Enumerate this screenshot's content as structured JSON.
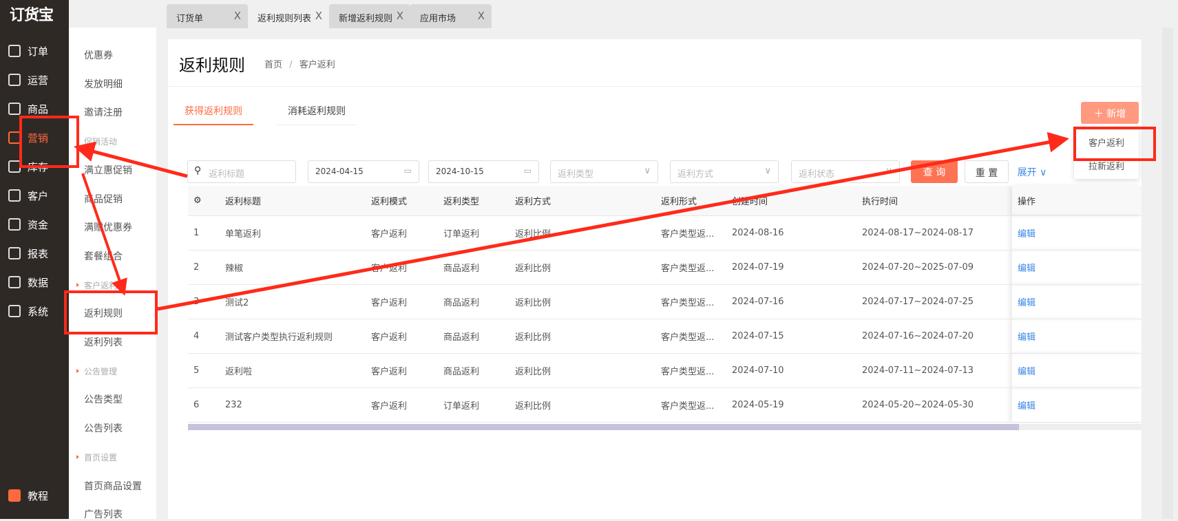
{
  "app": {
    "logo": "订货宝"
  },
  "nav": [
    {
      "label": "订单",
      "icon": "document-icon"
    },
    {
      "label": "运营",
      "icon": "chart-board-icon"
    },
    {
      "label": "商品",
      "icon": "grid-icon"
    },
    {
      "label": "营销",
      "icon": "bag-icon",
      "active": true
    },
    {
      "label": "库存",
      "icon": "warehouse-icon"
    },
    {
      "label": "客户",
      "icon": "user-icon"
    },
    {
      "label": "资金",
      "icon": "money-bag-icon"
    },
    {
      "label": "报表",
      "icon": "pie-icon"
    },
    {
      "label": "数据",
      "icon": "data-icon"
    },
    {
      "label": "系统",
      "icon": "monitor-icon"
    }
  ],
  "nav_bottom": {
    "label": "教程"
  },
  "submenu": [
    {
      "label": "优惠券"
    },
    {
      "label": "发放明细"
    },
    {
      "label": "邀请注册"
    },
    {
      "label": "促销活动",
      "group": true
    },
    {
      "label": "满立惠促销"
    },
    {
      "label": "商品促销"
    },
    {
      "label": "满赠优惠券"
    },
    {
      "label": "套餐组合"
    },
    {
      "label": "客户返利",
      "group": true
    },
    {
      "label": "返利规则"
    },
    {
      "label": "返利列表"
    },
    {
      "label": "公告管理",
      "group": true
    },
    {
      "label": "公告类型"
    },
    {
      "label": "公告列表"
    },
    {
      "label": "首页设置",
      "group": true
    },
    {
      "label": "首页商品设置"
    },
    {
      "label": "广告列表"
    }
  ],
  "tabs": [
    {
      "label": "订货单"
    },
    {
      "label": "返利规则列表",
      "active": true
    },
    {
      "label": "新增返利规则"
    },
    {
      "label": "应用市场"
    }
  ],
  "tab_close": "X",
  "page": {
    "title": "返利规则",
    "breadcrumb": [
      "首页",
      "/",
      "客户返利"
    ]
  },
  "page_tabs": [
    "获得返利规则",
    "消耗返利规则"
  ],
  "add_button": "＋ 新增",
  "add_menu": [
    "客户返利",
    "拉新返利"
  ],
  "filters": {
    "title_placeholder": "返利标题",
    "start_date": "2024-04-15",
    "end_date": "2024-10-15",
    "type_placeholder": "返利类型",
    "method_placeholder": "返利方式",
    "status_placeholder": "返利状态",
    "query": "查 询",
    "reset": "重 置",
    "expand": "展开"
  },
  "table": {
    "columns": [
      "返利标题",
      "返利模式",
      "返利类型",
      "返利方式",
      "返利形式",
      "创建时间",
      "执行时间",
      "操作"
    ],
    "rows": [
      [
        "1",
        "单笔返利",
        "客户返利",
        "订单返利",
        "返利比例",
        "客户类型返...",
        "2024-08-16",
        "2024-08-17~2024-08-17",
        "编辑"
      ],
      [
        "2",
        "辣椒",
        "客户返利",
        "商品返利",
        "返利比例",
        "客户类型返...",
        "2024-07-19",
        "2024-07-20~2025-07-09",
        "编辑"
      ],
      [
        "3",
        "测试2",
        "客户返利",
        "商品返利",
        "返利比例",
        "客户类型返...",
        "2024-07-16",
        "2024-07-17~2024-07-25",
        "编辑"
      ],
      [
        "4",
        "测试客户类型执行返利规则",
        "客户返利",
        "商品返利",
        "返利比例",
        "客户类型返...",
        "2024-07-15",
        "2024-07-16~2024-07-20",
        "编辑"
      ],
      [
        "5",
        "返利啦",
        "客户返利",
        "商品返利",
        "返利比例",
        "客户类型返...",
        "2024-07-10",
        "2024-07-11~2024-07-13",
        "编辑"
      ],
      [
        "6",
        "232",
        "客户返利",
        "订单返利",
        "返利比例",
        "客户类型返...",
        "2024-05-19",
        "2024-05-20~2024-05-30",
        "编辑"
      ]
    ]
  },
  "colors": {
    "accent": "#ff6a3d",
    "nav_bg": "#2f2926",
    "link": "#3a87e6",
    "annotation": "#ff2a1a"
  }
}
